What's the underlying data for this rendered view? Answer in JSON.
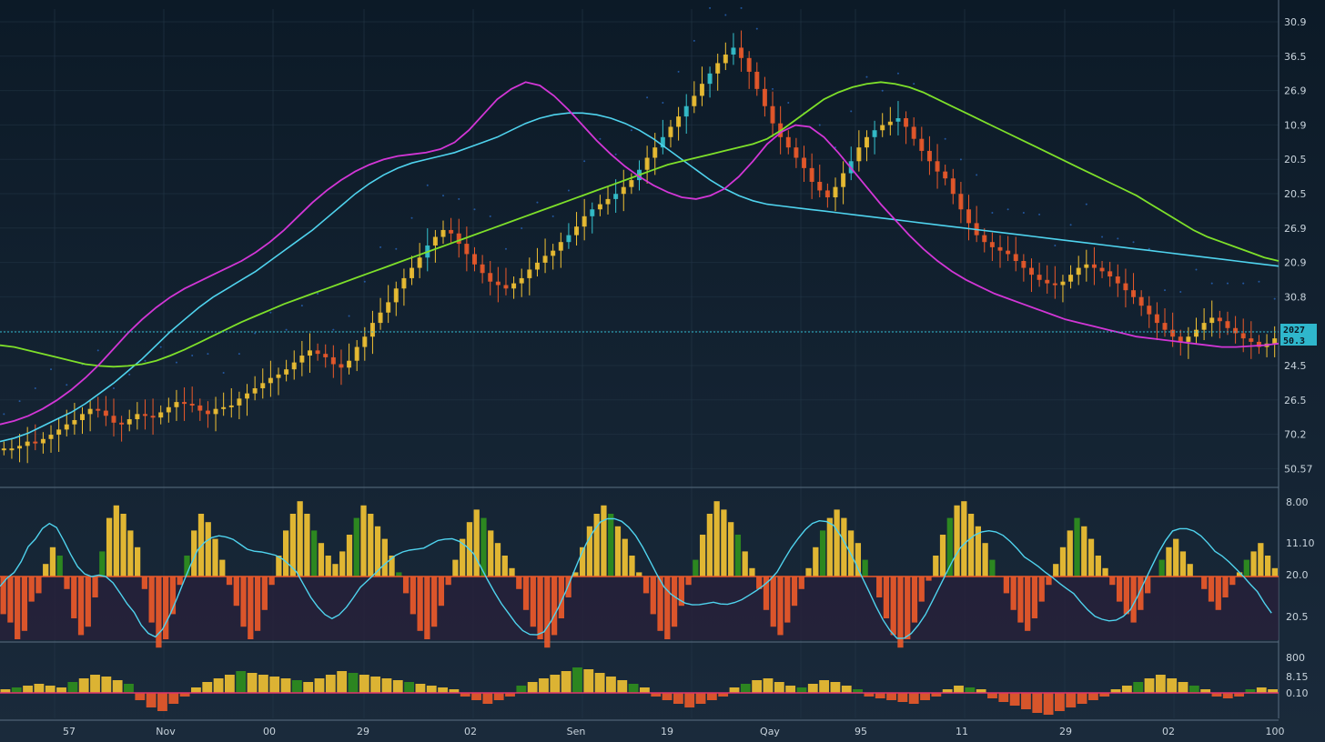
{
  "colors": {
    "background": "#0f1e2c",
    "grid": "#243748",
    "bull_candle": "#f2c233",
    "bear_candle": "#ec5a2a",
    "cyan_candle": "#35c3cf",
    "ma_green": "#7ee02a",
    "ma_magenta": "#d236d6",
    "ma_cyan": "#4fd3ee",
    "ma_orange": "#c98a2c",
    "price_line": "#2fb7cc",
    "osc_pos": "#f2c233",
    "osc_neg": "#ec5a2a",
    "osc_green": "#2f8f1e",
    "baseline": "#e0356e"
  },
  "chart_data": [
    {
      "type": "candlestick",
      "panel": "price",
      "y_tick_labels": [
        "30.9",
        "36.5",
        "26.9",
        "10.9",
        "20.5",
        "20.5",
        "26.9",
        "20.9",
        "30.8",
        "20.4",
        "24.5",
        "26.5",
        "70.2",
        "50.57"
      ],
      "current_price_tags": [
        "2027",
        "50.3"
      ],
      "x_tick_labels": [
        "57",
        "Nov",
        "00",
        "29",
        "02",
        "Sen",
        "19",
        "Qay",
        "95",
        "11",
        "29",
        "02",
        "100"
      ],
      "close_series": [
        22,
        22,
        25,
        30,
        28,
        33,
        38,
        44,
        50,
        55,
        62,
        68,
        66,
        60,
        52,
        50,
        56,
        62,
        60,
        58,
        64,
        70,
        76,
        74,
        72,
        66,
        62,
        68,
        70,
        72,
        80,
        86,
        92,
        98,
        104,
        108,
        114,
        122,
        130,
        136,
        132,
        128,
        120,
        116,
        124,
        140,
        152,
        168,
        180,
        192,
        208,
        220,
        232,
        244,
        258,
        268,
        276,
        272,
        260,
        248,
        236,
        226,
        216,
        212,
        208,
        214,
        220,
        230,
        238,
        246,
        252,
        262,
        270,
        280,
        292,
        300,
        306,
        312,
        318,
        326,
        334,
        346,
        360,
        372,
        384,
        396,
        408,
        420,
        432,
        446,
        458,
        470,
        480,
        488,
        476,
        460,
        440,
        420,
        400,
        384,
        372,
        360,
        348,
        332,
        322,
        314,
        326,
        342,
        356,
        372,
        384,
        392,
        398,
        402,
        406,
        396,
        382,
        368,
        356,
        344,
        336,
        318,
        300,
        284,
        270,
        262,
        256,
        252,
        248,
        240,
        232,
        224,
        218,
        214,
        212,
        216,
        224,
        232,
        236,
        232,
        228,
        222,
        214,
        206,
        198,
        188,
        178,
        168,
        160,
        152,
        146,
        152,
        160,
        168,
        174,
        170,
        162,
        156,
        150,
        146,
        140,
        144,
        150
      ],
      "ma_green": [
        142,
        140,
        136,
        132,
        128,
        124,
        120,
        118,
        117,
        118,
        120,
        124,
        130,
        137,
        145,
        153,
        161,
        169,
        176,
        183,
        190,
        196,
        202,
        208,
        214,
        220,
        226,
        232,
        238,
        244,
        250,
        256,
        262,
        268,
        274,
        280,
        286,
        292,
        298,
        304,
        310,
        316,
        322,
        328,
        334,
        340,
        346,
        352,
        356,
        360,
        364,
        368,
        372,
        376,
        382,
        392,
        404,
        416,
        428,
        436,
        442,
        446,
        448,
        446,
        442,
        436,
        428,
        420,
        412,
        404,
        396,
        388,
        380,
        372,
        364,
        356,
        348,
        340,
        332,
        324,
        316,
        306,
        296,
        286,
        276,
        268,
        262,
        256,
        250,
        244,
        240
      ],
      "ma_magenta": [
        50,
        54,
        60,
        68,
        78,
        90,
        104,
        120,
        138,
        156,
        172,
        186,
        198,
        208,
        216,
        224,
        232,
        240,
        250,
        262,
        276,
        292,
        308,
        322,
        334,
        344,
        352,
        358,
        362,
        364,
        366,
        370,
        378,
        392,
        410,
        428,
        440,
        448,
        444,
        432,
        416,
        398,
        380,
        364,
        350,
        338,
        328,
        320,
        314,
        312,
        316,
        324,
        338,
        356,
        376,
        390,
        398,
        396,
        384,
        366,
        346,
        326,
        306,
        288,
        270,
        254,
        240,
        228,
        218,
        210,
        202,
        196,
        190,
        184,
        178,
        172,
        168,
        164,
        160,
        156,
        152,
        150,
        148,
        146,
        144,
        142,
        140,
        140,
        141,
        142,
        144
      ],
      "ma_cyan": [
        30,
        34,
        40,
        48,
        56,
        64,
        74,
        86,
        98,
        112,
        126,
        142,
        158,
        172,
        186,
        198,
        208,
        218,
        228,
        240,
        252,
        264,
        276,
        290,
        304,
        318,
        330,
        340,
        348,
        354,
        358,
        362,
        366,
        372,
        378,
        384,
        392,
        400,
        406,
        410,
        412,
        412,
        410,
        406,
        400,
        392,
        382,
        370,
        358,
        346,
        334,
        324,
        316,
        310,
        306,
        304,
        302,
        300,
        298,
        296,
        294,
        292,
        290,
        288,
        286,
        284,
        282,
        280,
        278,
        276,
        274,
        272,
        270,
        268,
        266,
        264,
        262,
        260,
        258,
        256,
        254,
        252,
        250,
        248,
        246,
        244,
        242,
        240,
        238,
        236,
        234
      ],
      "volume_dots": true
    },
    {
      "type": "bar",
      "panel": "oscillator",
      "y_tick_labels": [
        "8.00",
        "11.10",
        "20.0",
        "20.5"
      ],
      "values": [
        -18,
        -22,
        -30,
        -26,
        -12,
        -8,
        6,
        14,
        10,
        -6,
        -20,
        -28,
        -24,
        -10,
        12,
        28,
        34,
        30,
        22,
        14,
        -6,
        -22,
        -34,
        -30,
        -18,
        -4,
        10,
        22,
        30,
        26,
        18,
        8,
        -4,
        -14,
        -24,
        -30,
        -26,
        -16,
        -4,
        10,
        22,
        30,
        36,
        30,
        22,
        16,
        10,
        6,
        12,
        20,
        28,
        34,
        30,
        24,
        18,
        10,
        2,
        -8,
        -18,
        -26,
        -30,
        -24,
        -14,
        -4,
        8,
        18,
        26,
        32,
        28,
        22,
        16,
        10,
        4,
        -6,
        -16,
        -24,
        -30,
        -34,
        -28,
        -20,
        -10,
        2,
        14,
        24,
        30,
        34,
        30,
        24,
        18,
        10,
        2,
        -8,
        -18,
        -26,
        -30,
        -24,
        -14,
        -4,
        8,
        20,
        30,
        36,
        32,
        26,
        20,
        12,
        4,
        -6,
        -16,
        -24,
        -28,
        -22,
        -14,
        -6,
        4,
        14,
        22,
        28,
        32,
        28,
        22,
        16,
        8,
        0,
        -10,
        -20,
        -28,
        -34,
        -30,
        -22,
        -12,
        -2,
        10,
        20,
        28,
        34,
        36,
        30,
        24,
        16,
        8,
        0,
        -8,
        -16,
        -22,
        -26,
        -20,
        -12,
        -4,
        6,
        14,
        22,
        28,
        24,
        18,
        10,
        4,
        -4,
        -12,
        -18,
        -22,
        -16,
        -8,
        0,
        8,
        14,
        18,
        12,
        6,
        0,
        -6,
        -12,
        -16,
        -10,
        -4,
        2,
        8,
        12,
        16,
        10,
        4
      ]
    },
    {
      "type": "bar",
      "panel": "volume_oscillator",
      "y_tick_labels": [
        "800",
        "8.15",
        "0.10"
      ],
      "values": [
        2,
        3,
        4,
        5,
        4,
        3,
        6,
        8,
        10,
        9,
        7,
        5,
        -4,
        -8,
        -10,
        -6,
        -2,
        3,
        6,
        8,
        10,
        12,
        11,
        10,
        9,
        8,
        7,
        6,
        8,
        10,
        12,
        11,
        10,
        9,
        8,
        7,
        6,
        5,
        4,
        3,
        2,
        -2,
        -4,
        -6,
        -4,
        -2,
        4,
        6,
        8,
        10,
        12,
        14,
        13,
        11,
        9,
        7,
        5,
        3,
        -2,
        -4,
        -6,
        -8,
        -6,
        -4,
        -2,
        3,
        5,
        7,
        8,
        6,
        4,
        3,
        5,
        7,
        6,
        4,
        2,
        -2,
        -3,
        -4,
        -5,
        -6,
        -4,
        -2,
        2,
        4,
        3,
        2,
        -3,
        -5,
        -7,
        -9,
        -11,
        -12,
        -10,
        -8,
        -6,
        -4,
        -2,
        2,
        4,
        6,
        8,
        10,
        8,
        6,
        4,
        2,
        -2,
        -3,
        -2,
        2,
        3,
        2
      ]
    }
  ]
}
